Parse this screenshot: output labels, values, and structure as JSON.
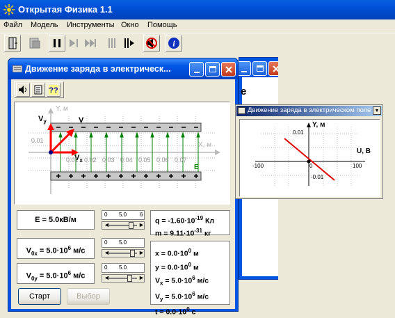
{
  "app": {
    "title": "Открытая Физика 1.1"
  },
  "menu": [
    "Файл",
    "Модель",
    "Инструменты",
    "Окно",
    "Помощь"
  ],
  "main_window": {
    "title": "Движение заряда в электрическ...",
    "bg_letters": "е"
  },
  "plot_window": {
    "title": "Движение заряда в электрическом поле",
    "y_label": "Y, м",
    "x_label": "U, В",
    "y_top": "0.01",
    "y_bottom": "-0.01",
    "x_left": "-100",
    "x_right": "100",
    "origin": "0"
  },
  "field": {
    "y_label": "Y, м",
    "x_label": "X, м",
    "v_label": "V",
    "vx_label": "V",
    "vx_sub": "x",
    "vy_label": "V",
    "vy_sub": "y",
    "e_label": "E",
    "y_tick": "0.01",
    "x_ticks": [
      "0.01",
      "0.02",
      "0.03",
      "0.04",
      "0.05",
      "0.06",
      "0.07"
    ]
  },
  "params": {
    "e_field": "E = 5.0кВ/м",
    "v0x_pre": "V",
    "v0x_sub": "0x",
    "v0x_post": " = 5.0·10",
    "v0x_exp": "6",
    "v0x_unit": " м/с",
    "v0y_pre": "V",
    "v0y_sub": "0y",
    "v0y_post": " = 5.0·10",
    "v0y_exp": "6",
    "v0y_unit": " м/с"
  },
  "sliders": {
    "s1_ticks": [
      "0",
      "5.0",
      "6"
    ],
    "s2_ticks": [
      "0",
      "5.0"
    ],
    "s3_ticks": [
      "0",
      "5.0"
    ]
  },
  "charge": {
    "q_pre": "q = -1.60·10",
    "q_exp": "-19",
    "q_unit": " Кл",
    "m_pre": "m = 9.11·10",
    "m_exp": "-31",
    "m_unit": " кг"
  },
  "state": {
    "x_pre": "x = 0.0·10",
    "x_exp": "0",
    "x_unit": " м",
    "y_pre": "y = 0.0·10",
    "y_exp": "0",
    "y_unit": " м",
    "vx_pre": "V",
    "vx_sub": "x",
    "vx_post": " = 5.0·10",
    "vx_exp": "6",
    "vx_unit": " м/с",
    "vy_pre": "V",
    "vy_sub": "y",
    "vy_post": " = 5.0·10",
    "vy_exp": "6",
    "vy_unit": " м/с",
    "t_pre": "t = 0.0·10",
    "t_exp": "0",
    "t_unit": " с"
  },
  "buttons": {
    "start": "Старт",
    "select": "Выбор"
  },
  "colors": {
    "xp_blue": "#0054e3",
    "arrow_red": "#ff0000",
    "field_green": "#008000"
  }
}
